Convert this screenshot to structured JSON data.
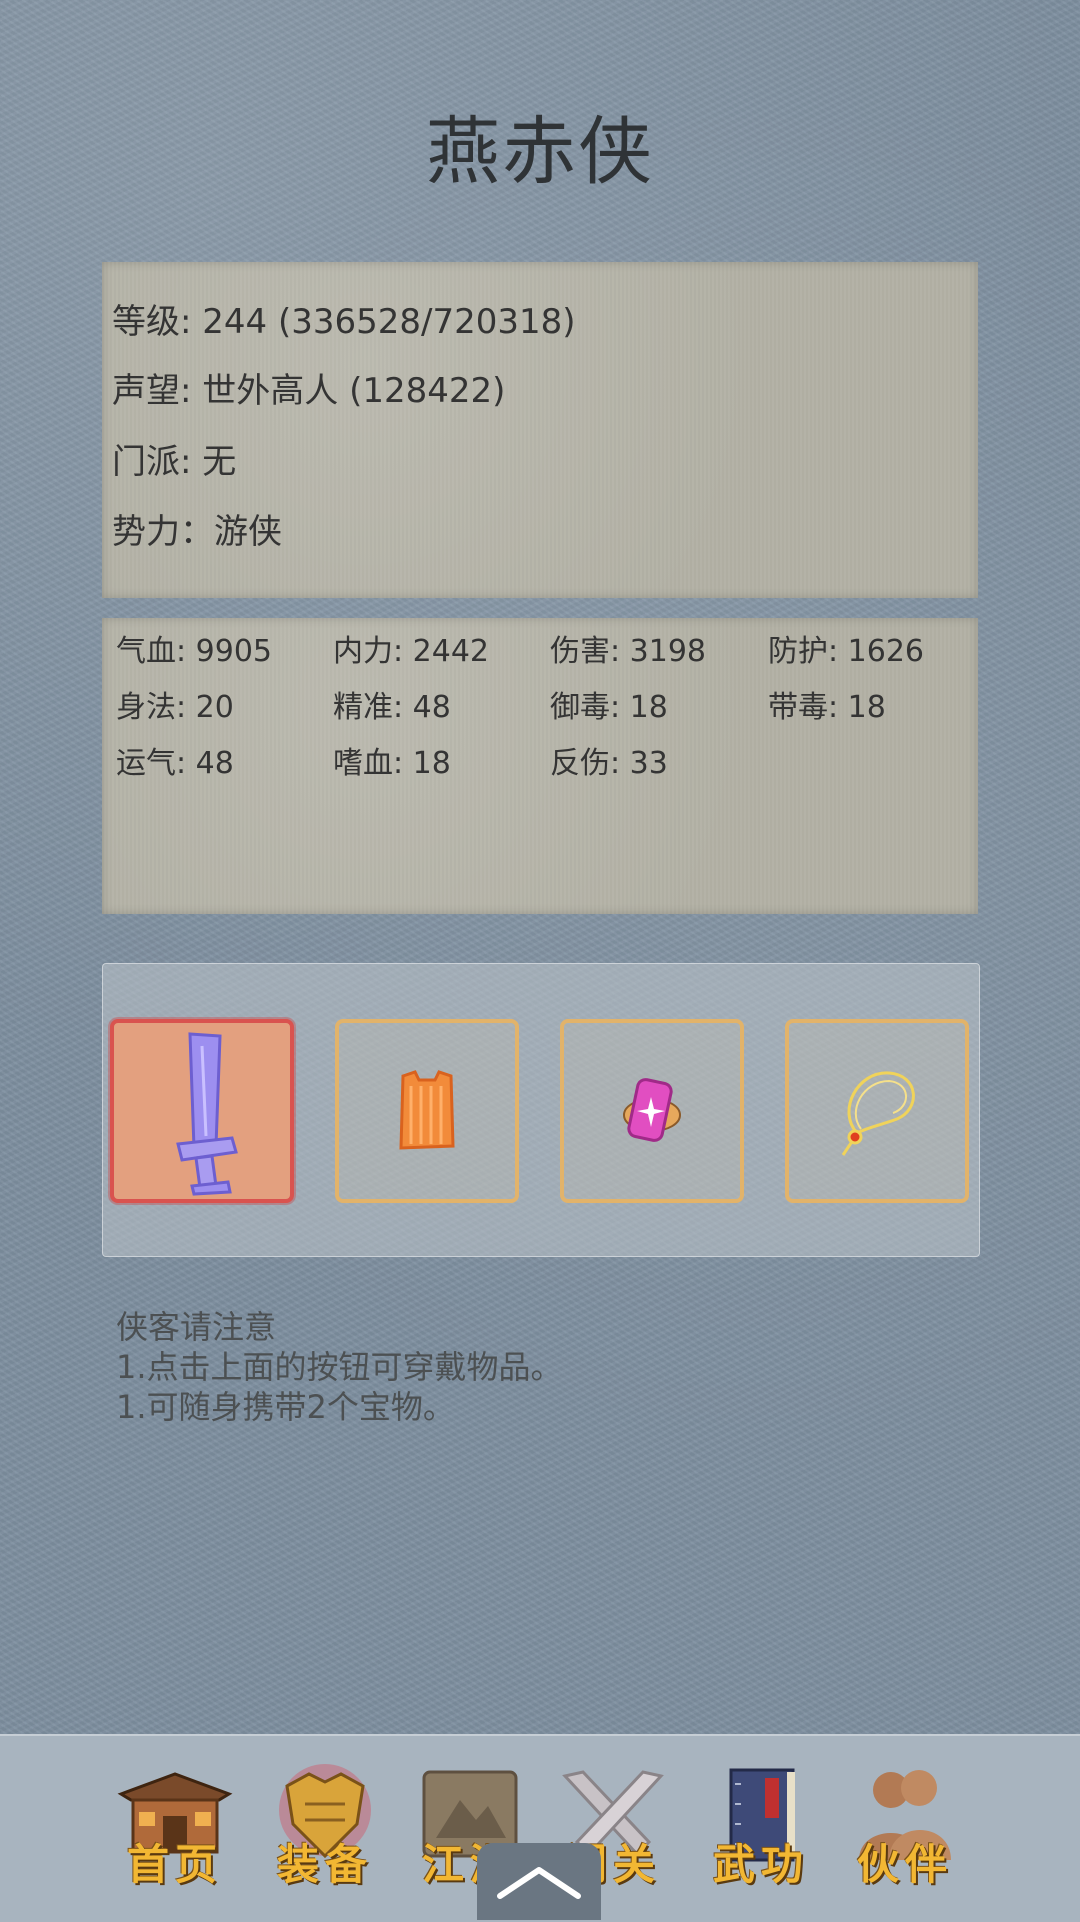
{
  "character_name": "燕赤侠",
  "info": {
    "level": "等级: 244 (336528/720318)",
    "reputation": "声望: 世外高人 (128422)",
    "sect": "门派: 无",
    "faction": "势力：游侠"
  },
  "stats": [
    {
      "label": "气血: 9905"
    },
    {
      "label": "内力: 2442"
    },
    {
      "label": "伤害: 3198"
    },
    {
      "label": "防护: 1626"
    },
    {
      "label": "身法: 20"
    },
    {
      "label": "精准: 48"
    },
    {
      "label": "御毒: 18"
    },
    {
      "label": "带毒: 18"
    },
    {
      "label": "运气: 48"
    },
    {
      "label": "嗜血: 18"
    },
    {
      "label": "反伤: 33"
    }
  ],
  "equipment_slots": [
    {
      "icon": "sword-icon",
      "selected": true
    },
    {
      "icon": "armor-vest-icon",
      "selected": false
    },
    {
      "icon": "pink-charm-icon",
      "selected": false
    },
    {
      "icon": "necklace-icon",
      "selected": false
    }
  ],
  "notes": {
    "heading": "侠客请注意",
    "line1": "1.点击上面的按钮可穿戴物品。",
    "line2": "1.可随身携带2个宝物。"
  },
  "nav": [
    {
      "label": "首页",
      "icon": "house-icon"
    },
    {
      "label": "装备",
      "icon": "armor-icon"
    },
    {
      "label": "江湖",
      "icon": "scroll-map-icon"
    },
    {
      "label": "闯关",
      "icon": "crossed-swords-icon"
    },
    {
      "label": "武功",
      "icon": "book-icon"
    },
    {
      "label": "伙伴",
      "icon": "companions-icon"
    }
  ],
  "colors": {
    "accent_gold": "#f2b733",
    "selected_slot": "#e3a07f",
    "slot_border": "#e2b36a"
  }
}
